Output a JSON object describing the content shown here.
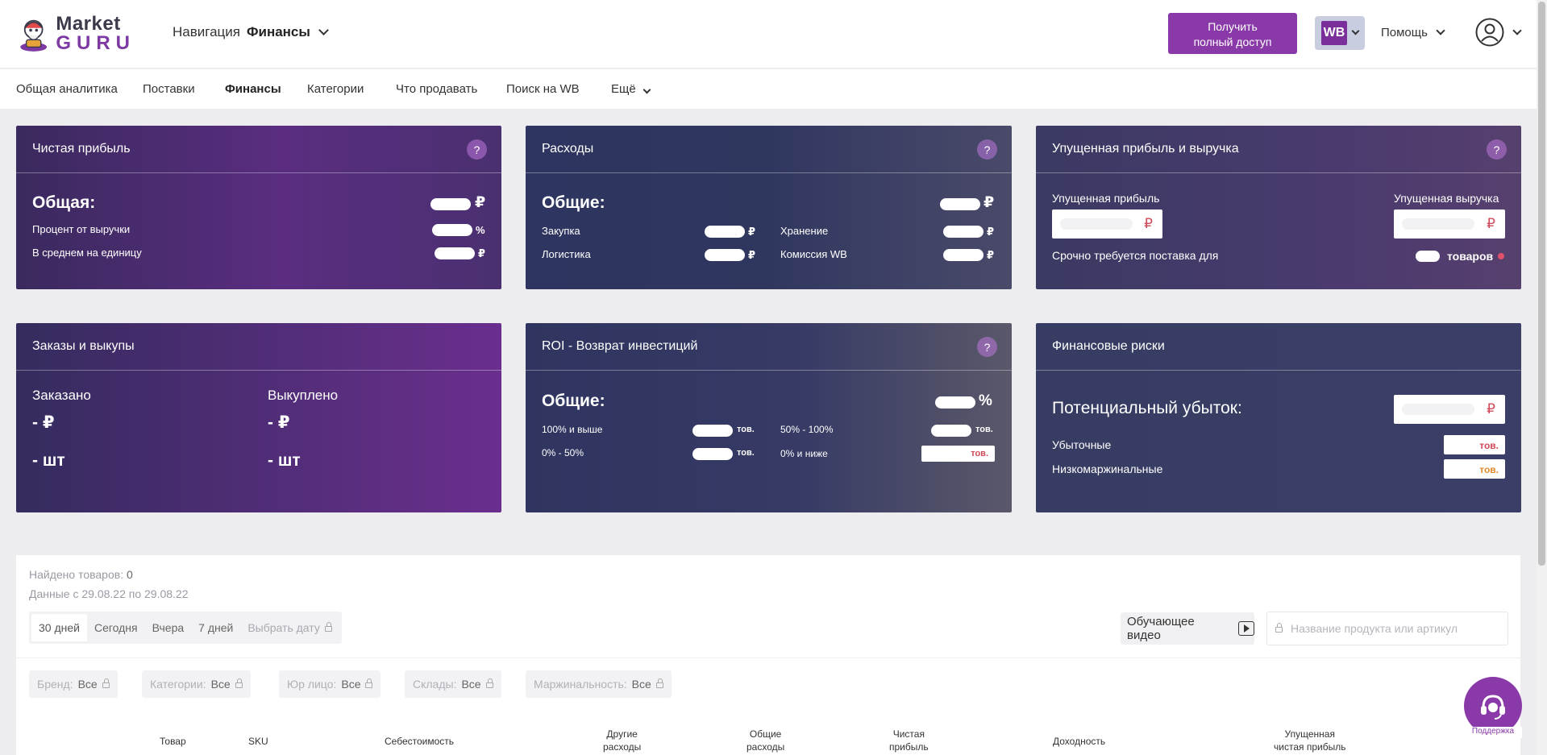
{
  "header": {
    "logo_line1": "Market",
    "logo_line2": "GURU",
    "nav_label": "Навигация",
    "nav_current": "Финансы",
    "cta_line1": "Получить",
    "cta_line2": "полный доступ",
    "marketplace_badge": "WB",
    "help_label": "Помощь"
  },
  "tabs": [
    "Общая аналитика",
    "Поставки",
    "Финансы",
    "Категории",
    "Что продавать",
    "Поиск на WB",
    "Ещё"
  ],
  "cards": {
    "net_profit": {
      "title": "Чистая прибыль",
      "help": "?",
      "total_label": "Общая:",
      "total_unit": "₽",
      "row1_label": "Процент от выручки",
      "row1_unit": "%",
      "row2_label": "В среднем на единицу",
      "row2_unit": "₽"
    },
    "expenses": {
      "title": "Расходы",
      "help": "?",
      "total_label": "Общие:",
      "total_unit": "₽",
      "purchase": "Закупка",
      "logistics": "Логистика",
      "storage": "Хранение",
      "commission": "Комиссия WB",
      "unit": "₽"
    },
    "lost": {
      "title": "Упущенная прибыль и выручка",
      "help": "?",
      "lost_profit": "Упущенная прибыль",
      "lost_revenue": "Упущенная выручка",
      "unit": "₽",
      "urgent_label": "Срочно требуется поставка для",
      "urgent_unit": "товаров"
    },
    "orders": {
      "title": "Заказы и выкупы",
      "ordered_label": "Заказано",
      "bought_label": "Выкуплено",
      "ordered_rub": "- ₽",
      "bought_rub": "- ₽",
      "ordered_pcs": "- шт",
      "bought_pcs": "- шт"
    },
    "roi": {
      "title": "ROI - Возврат инвестиций",
      "help": "?",
      "total_label": "Общие:",
      "total_unit": "%",
      "r1": "100% и выше",
      "r2": "0% - 50%",
      "r3": "50% - 100%",
      "r4": "0% и ниже",
      "unit": "тов."
    },
    "risks": {
      "title": "Финансовые риски",
      "potential_loss": "Потенциальный убыток:",
      "unit": "₽",
      "unprofitable": "Убыточные",
      "low_margin": "Низкомаржинальные",
      "count_unit": "тов."
    }
  },
  "panel": {
    "found_label": "Найдено товаров:",
    "found_count": "0",
    "date_range": "Данные с 29.08.22 по 29.08.22",
    "date_buttons": [
      "30 дней",
      "Сегодня",
      "Вчера",
      "7 дней",
      "Выбрать дату"
    ],
    "video_button": "Обучающее видео",
    "search_placeholder": "Название продукта или артикул",
    "filters": [
      {
        "label": "Бренд:",
        "value": "Все"
      },
      {
        "label": "Категории:",
        "value": "Все"
      },
      {
        "label": "Юр лицо:",
        "value": "Все"
      },
      {
        "label": "Склады:",
        "value": "Все"
      },
      {
        "label": "Маржинальность:",
        "value": "Все"
      }
    ]
  },
  "table_headers": {
    "product": "Товар",
    "sku": "SKU",
    "cost": "Себестоимость",
    "other1": "Другие",
    "other2": "расходы",
    "total1": "Общие",
    "total2": "расходы",
    "net1": "Чистая",
    "net2": "прибыль",
    "yield": "Доходность",
    "lost1": "Упущенная",
    "lost2": "чистая прибыль"
  },
  "support_label": "Поддержка",
  "colors": {
    "accent": "#8a3aa8",
    "card_dark": "#2f3560",
    "card_purple": "#6a2e8e"
  }
}
